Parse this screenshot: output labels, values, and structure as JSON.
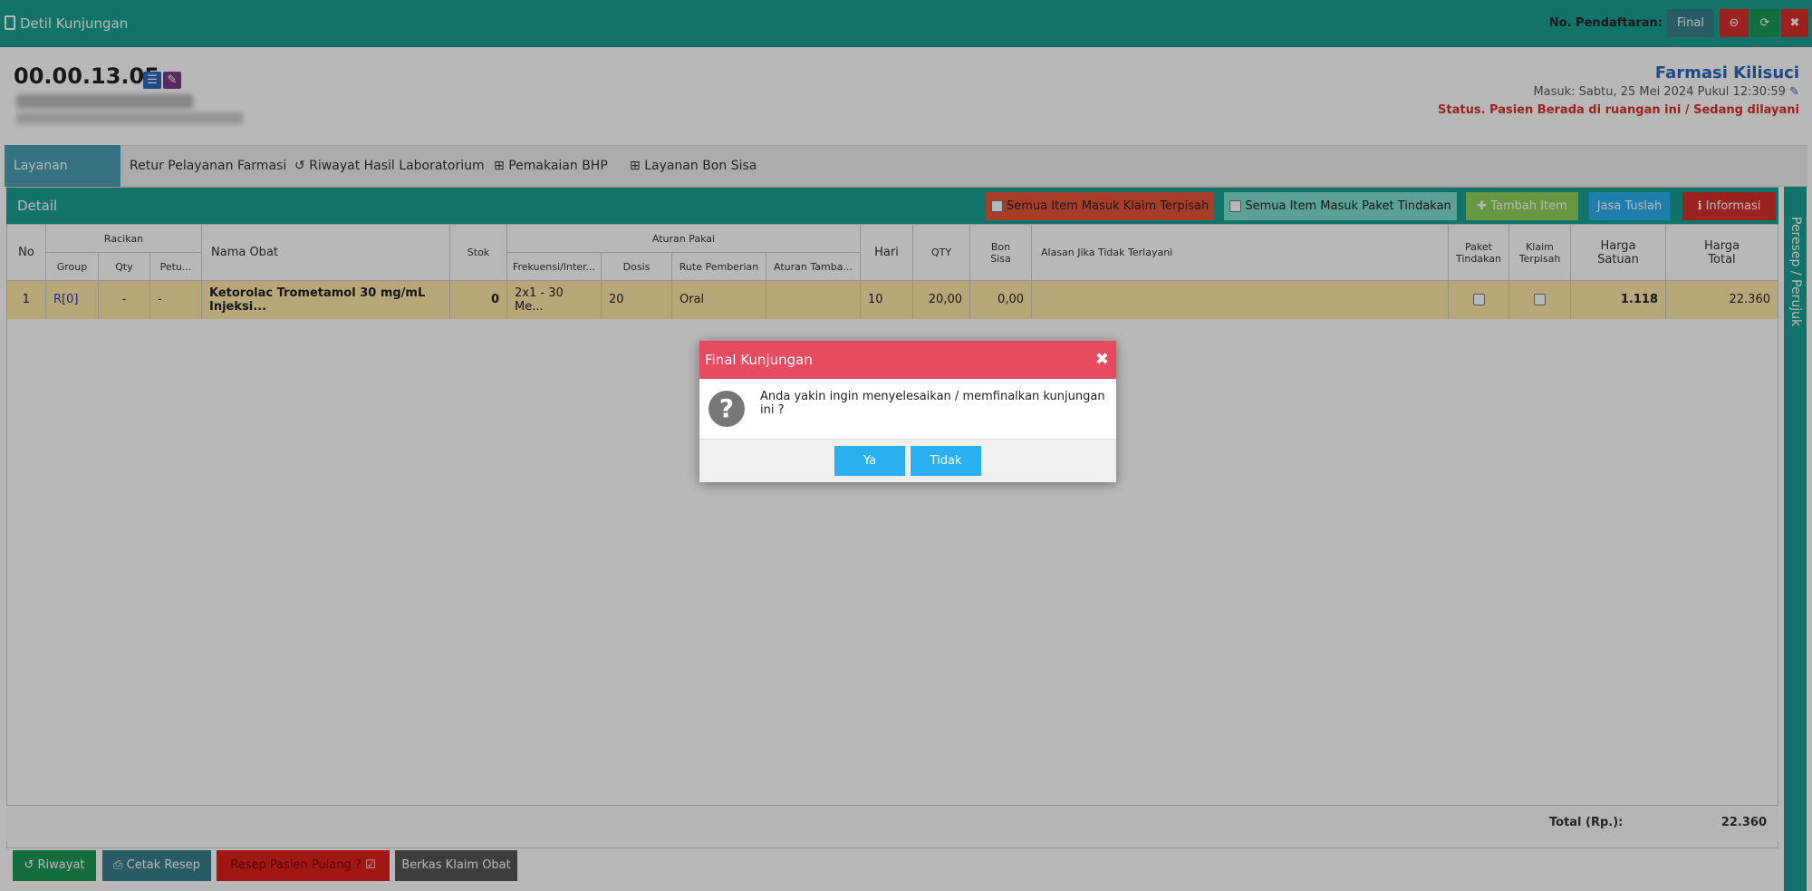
{
  "topbar": {
    "title": "Detil Kunjungan",
    "no_pendaftaran_label": "No. Pendaftaran:",
    "final_label": "Final"
  },
  "patient": {
    "reg_no": "00.00.13.05",
    "unit": "Farmasi Kilisuci",
    "masuk": "Masuk: Sabtu, 25 Mei 2024 Pukul 12:30:59",
    "status": "Status. Pasien Berada di ruangan ini / Sedang dilayani"
  },
  "tabs": [
    {
      "label": "Layanan Farmasi"
    },
    {
      "label": "Retur Pelayanan Farmasi"
    },
    {
      "label": "Riwayat Hasil Laboratorium"
    },
    {
      "label": "Pemakaian BHP"
    },
    {
      "label": "Layanan Bon Sisa"
    }
  ],
  "panel": {
    "title": "Detail",
    "buttons": {
      "klaim": "Semua Item Masuk Klaim Terpisah",
      "paket": "Semua Item Masuk Paket Tindakan",
      "tambah": "Tambah Item",
      "jasa": "Jasa Tuslah",
      "info": "Informasi"
    }
  },
  "table": {
    "headers": {
      "no": "No",
      "racikan": "Racikan",
      "group": "Group",
      "qty_r": "Qty",
      "petu": "Petu...",
      "nama": "Nama Obat",
      "stok": "Stok",
      "aturan": "Aturan Pakai",
      "frek": "Frekuensi/Inter...",
      "dosis": "Dosis",
      "rute": "Rute Pemberian",
      "tamba": "Aturan Tamba...",
      "hari": "Hari",
      "qty": "QTY",
      "bon1": "Bon",
      "bon2": "Sisa",
      "alasan": "Alasan Jika Tidak Terlayani",
      "paket1": "Paket",
      "paket2": "Tindakan",
      "klaim1": "Klaim",
      "klaim2": "Terpisah",
      "hs1": "Harga",
      "hs2": "Satuan",
      "ht1": "Harga",
      "ht2": "Total"
    },
    "row": {
      "no": "1",
      "group": "R[0]",
      "qty": "-",
      "petu": "-",
      "nama": "Ketorolac Trometamol 30 mg/mL Injeksi...",
      "stok": "0",
      "frek": "2x1 - 30 Me...",
      "dosis": "20",
      "rute": "Oral",
      "tamba": "",
      "hari": "10",
      "qty_val": "20,00",
      "bon": "0,00",
      "alasan": "",
      "harga_satuan": "1.118",
      "harga_total": "22.360"
    },
    "total_label": "Total (Rp.):",
    "total_value": "22.360"
  },
  "bottom": {
    "riwayat": "Riwayat",
    "cetak": "Cetak Resep",
    "resep": "Resep Pasien Pulang ?",
    "berkas": "Berkas Klaim Obat"
  },
  "side": {
    "label": "Peresep / Perujuk"
  },
  "modal": {
    "title": "Final Kunjungan",
    "message": "Anda yakin ingin menyelesaikan / memfinalkan kunjungan ini ?",
    "yes": "Ya",
    "no": "Tidak"
  },
  "colors": {
    "teal": "#19a095",
    "danger": "#e84a5f",
    "primary_btn": "#2ab0f0"
  }
}
